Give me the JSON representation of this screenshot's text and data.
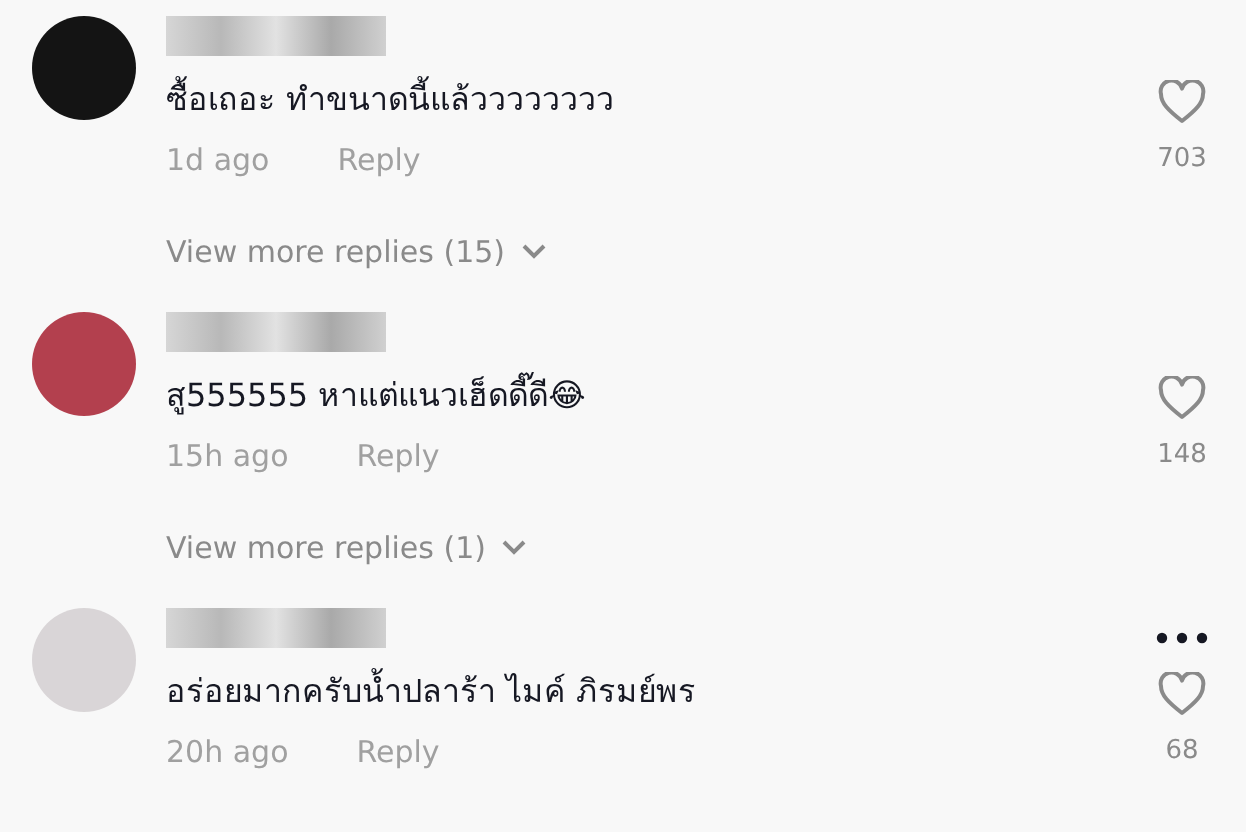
{
  "comments": [
    {
      "color": "#141414",
      "text": "ซื้อเถอะ ทำขนาดนี้แล้วววววววว",
      "time": "1d ago",
      "reply": "Reply",
      "likes": "703",
      "more_menu": false,
      "view_replies": "View more replies (15)"
    },
    {
      "color": "#b3404e",
      "text": "สู555555 หาแต่แนวเฮ็ดดี๊ดี😂",
      "time": "15h ago",
      "reply": "Reply",
      "likes": "148",
      "more_menu": false,
      "view_replies": "View more replies (1)"
    },
    {
      "color": "#d9d5d7",
      "text": "อร่อยมากครับน้ำปลาร้า ไมค์ ภิรมย์พร",
      "time": "20h ago",
      "reply": "Reply",
      "likes": "68",
      "more_menu": true
    }
  ]
}
